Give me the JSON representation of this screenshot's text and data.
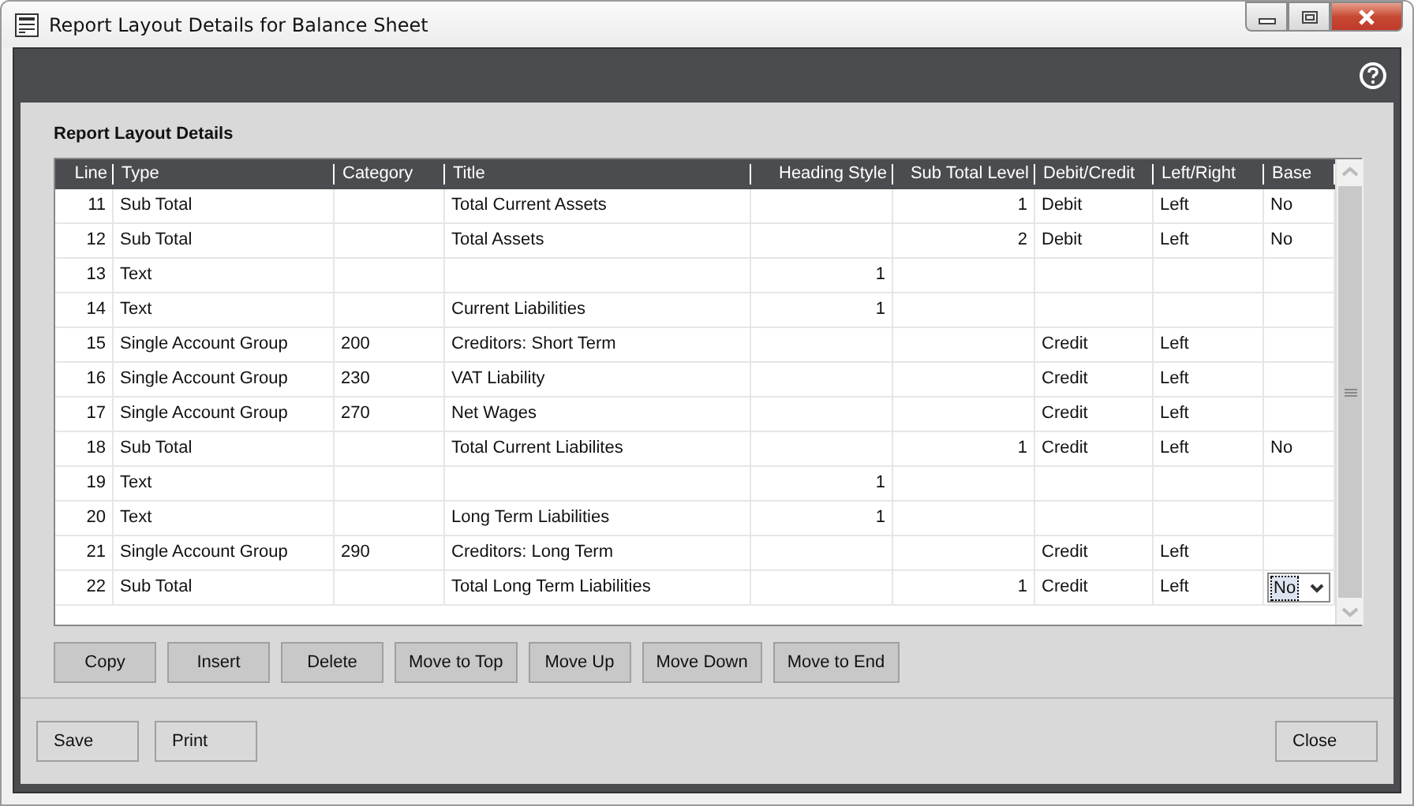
{
  "window": {
    "title": "Report Layout Details for Balance Sheet"
  },
  "panel": {
    "title": "Report Layout Details"
  },
  "table": {
    "columns": [
      "Line",
      "Type",
      "Category",
      "Title",
      "Heading Style",
      "Sub Total Level",
      "Debit/Credit",
      "Left/Right",
      "Base"
    ],
    "rows": [
      {
        "cells": [
          "11",
          "Sub Total",
          "",
          "Total Current Assets",
          "",
          "1",
          "Debit",
          "Left",
          "No"
        ],
        "editing": false
      },
      {
        "cells": [
          "12",
          "Sub Total",
          "",
          "Total Assets",
          "",
          "2",
          "Debit",
          "Left",
          "No"
        ],
        "editing": false
      },
      {
        "cells": [
          "13",
          "Text",
          "",
          "",
          "1",
          "",
          "",
          "",
          ""
        ],
        "editing": false
      },
      {
        "cells": [
          "14",
          "Text",
          "",
          "Current Liabilities",
          "1",
          "",
          "",
          "",
          ""
        ],
        "editing": false
      },
      {
        "cells": [
          "15",
          "Single Account Group",
          "200",
          "Creditors: Short Term",
          "",
          "",
          "Credit",
          "Left",
          ""
        ],
        "editing": false
      },
      {
        "cells": [
          "16",
          "Single Account Group",
          "230",
          "VAT Liability",
          "",
          "",
          "Credit",
          "Left",
          ""
        ],
        "editing": false
      },
      {
        "cells": [
          "17",
          "Single Account Group",
          "270",
          "Net Wages",
          "",
          "",
          "Credit",
          "Left",
          ""
        ],
        "editing": false
      },
      {
        "cells": [
          "18",
          "Sub Total",
          "",
          "Total Current Liabilites",
          "",
          "1",
          "Credit",
          "Left",
          "No"
        ],
        "editing": false
      },
      {
        "cells": [
          "19",
          "Text",
          "",
          "",
          "1",
          "",
          "",
          "",
          ""
        ],
        "editing": false
      },
      {
        "cells": [
          "20",
          "Text",
          "",
          "Long Term Liabilities",
          "1",
          "",
          "",
          "",
          ""
        ],
        "editing": false
      },
      {
        "cells": [
          "21",
          "Single Account Group",
          "290",
          "Creditors: Long Term",
          "",
          "",
          "Credit",
          "Left",
          ""
        ],
        "editing": false
      },
      {
        "cells": [
          "22",
          "Sub Total",
          "",
          "Total Long Term Liabilities",
          "",
          "1",
          "Credit",
          "Left",
          "No"
        ],
        "editing": true
      }
    ]
  },
  "row_buttons": [
    "Copy",
    "Insert",
    "Delete",
    "Move to Top",
    "Move Up",
    "Move Down",
    "Move to End"
  ],
  "footer_left": [
    "Save",
    "Print"
  ],
  "footer_right": [
    "Close"
  ]
}
